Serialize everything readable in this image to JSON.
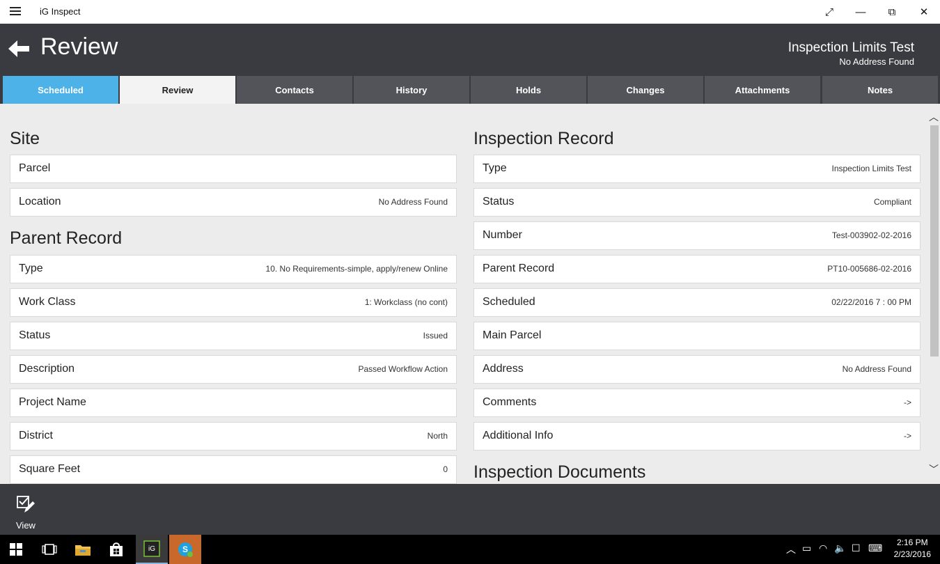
{
  "window": {
    "app_title": "iG Inspect",
    "controls": {
      "fullscreen": "⤢",
      "minimize": "—",
      "restore": "⧉",
      "close": "✕"
    }
  },
  "header": {
    "title": "Review",
    "record_name": "Inspection Limits Test",
    "record_address": "No Address Found"
  },
  "tabs": [
    {
      "label": "Scheduled",
      "state": "highlighted"
    },
    {
      "label": "Review",
      "state": "active"
    },
    {
      "label": "Contacts"
    },
    {
      "label": "History"
    },
    {
      "label": "Holds"
    },
    {
      "label": "Changes"
    },
    {
      "label": "Attachments"
    },
    {
      "label": "Notes"
    }
  ],
  "site": {
    "heading": "Site",
    "rows": [
      {
        "label": "Parcel",
        "value": ""
      },
      {
        "label": "Location",
        "value": "No Address Found"
      }
    ]
  },
  "parent_record": {
    "heading": "Parent Record",
    "rows": [
      {
        "label": "Type",
        "value": "10. No Requirements-simple, apply/renew Online"
      },
      {
        "label": "Work Class",
        "value": "1: Workclass (no cont)"
      },
      {
        "label": "Status",
        "value": "Issued"
      },
      {
        "label": "Description",
        "value": "Passed Workflow Action"
      },
      {
        "label": "Project Name",
        "value": ""
      },
      {
        "label": "District",
        "value": "North"
      },
      {
        "label": "Square Feet",
        "value": "0"
      }
    ]
  },
  "inspection_record": {
    "heading": "Inspection Record",
    "rows": [
      {
        "label": "Type",
        "value": "Inspection Limits Test"
      },
      {
        "label": "Status",
        "value": "Compliant"
      },
      {
        "label": "Number",
        "value": "Test-003902-02-2016"
      },
      {
        "label": "Parent Record",
        "value": "PT10-005686-02-2016"
      },
      {
        "label": "Scheduled",
        "value": "02/22/2016 7 : 00 PM"
      },
      {
        "label": "Main Parcel",
        "value": ""
      },
      {
        "label": "Address",
        "value": "No Address Found"
      },
      {
        "label": "Comments",
        "value": "->"
      },
      {
        "label": "Additional Info",
        "value": "->"
      }
    ]
  },
  "inspection_documents": {
    "heading": "Inspection Documents"
  },
  "appbar": {
    "view_label": "View"
  },
  "taskbar": {
    "time": "2:16 PM",
    "date": "2/23/2016",
    "icons": [
      "windows-start-icon",
      "task-view-icon",
      "file-explorer-icon",
      "store-icon",
      "ig-inspect-app-icon",
      "skype-icon"
    ],
    "colors": {
      "skype_tile": "#c8682a",
      "app_tile": "#3a3a3a"
    }
  },
  "theme": {
    "header_bg": "#3a3b40",
    "tab_bg": "#53545a",
    "tab_highlight": "#4db2e8",
    "content_bg": "#ececec"
  }
}
